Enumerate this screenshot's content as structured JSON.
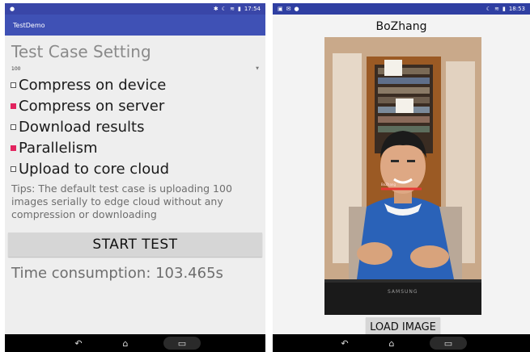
{
  "left_phone": {
    "status_bar": {
      "time": "17:54"
    },
    "app_title": "TestDemo",
    "heading": "Test Case Setting",
    "spinner_value": "100",
    "options": [
      {
        "label": "Compress on device",
        "checked": false
      },
      {
        "label": "Compress on server",
        "checked": true
      },
      {
        "label": "Download results",
        "checked": false
      },
      {
        "label": "Parallelism",
        "checked": true
      },
      {
        "label": "Upload to core cloud",
        "checked": false
      }
    ],
    "tips": "Tips: The default test case is uploading 100 images serially to edge cloud without any compression or downloading",
    "start_button": "START TEST",
    "time_consumption": "Time consumption: 103.465s"
  },
  "right_phone": {
    "status_bar": {
      "time": "18:53"
    },
    "photo_title": "BoZhang",
    "face_label": "BoZhang",
    "monitor_brand": "SAMSUNG",
    "load_button": "LOAD IMAGE"
  },
  "colors": {
    "primary": "#3f51b5",
    "accent": "#e2245f",
    "face_box": "#e53935"
  }
}
